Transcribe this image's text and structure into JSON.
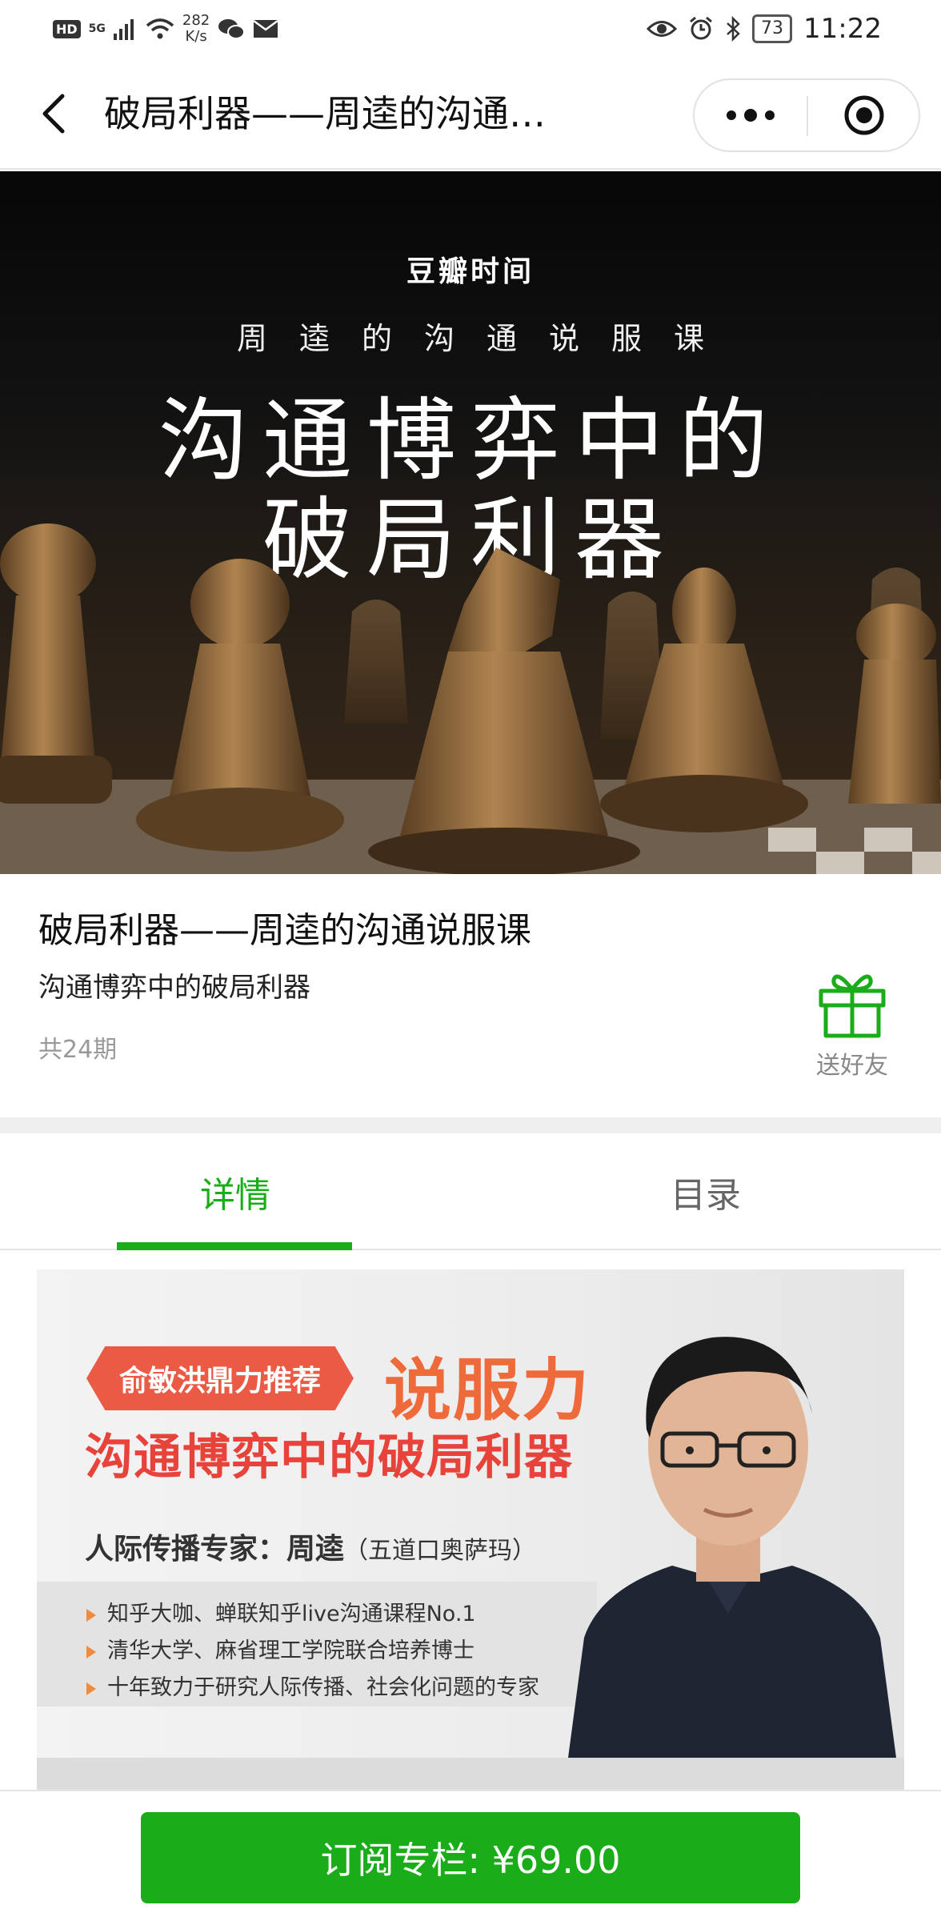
{
  "status_bar": {
    "hd": "HD",
    "signal": "5G",
    "speed_value": "282",
    "speed_unit": "K/s",
    "battery": "73",
    "time": "11:22"
  },
  "nav": {
    "title": "破局利器——周逵的沟通…"
  },
  "hero": {
    "brand": "豆瓣时间",
    "subtitle": "周逵的沟通说服课",
    "title_line1": "沟通博弈中的",
    "title_line2": "破局利器"
  },
  "course": {
    "title": "破局利器——周逵的沟通说服课",
    "subtitle": "沟通博弈中的破局利器",
    "episodes": "共24期",
    "gift_label": "送好友"
  },
  "tabs": [
    {
      "label": "详情",
      "active": true
    },
    {
      "label": "目录",
      "active": false
    }
  ],
  "banner": {
    "recommend": "俞敏洪鼎力推荐",
    "headline": "说服力",
    "slogan": "沟通博弈中的破局利器",
    "expert_label": "人际传播专家：周逵",
    "expert_alias": "（五道口奥萨玛）",
    "points": [
      "知乎大咖、蝉联知乎live沟通课程No.1",
      "清华大学、麻省理工学院联合培养博士",
      "十年致力于研究人际传播、社会化问题的专家"
    ]
  },
  "subscribe": {
    "label": "订阅专栏: ¥69.00"
  },
  "colors": {
    "accent": "#1aad19",
    "banner_red": "#e8433b",
    "banner_orange": "#ef6a3a"
  }
}
